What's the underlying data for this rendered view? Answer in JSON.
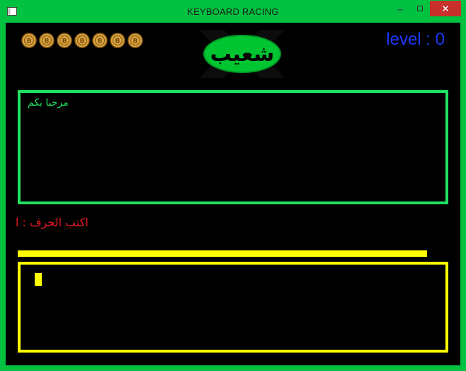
{
  "window": {
    "title": "KEYBOARD RACING"
  },
  "coins": {
    "count": 7,
    "icon": "bitcoin-coin-icon",
    "symbol": "B"
  },
  "logo": {
    "text": "شعيب"
  },
  "level": {
    "text": "level : 0"
  },
  "message": {
    "text": "مرحبا بكم"
  },
  "prompt": {
    "text": "اكتب الحرف : ا"
  },
  "progress": {
    "value": 1.0
  },
  "input": {
    "value": ""
  },
  "colors": {
    "frame": "#00c140",
    "message_border": "#1fe060",
    "level_text": "#1a3bff",
    "prompt_text": "#ee1c24",
    "input_border": "#ffff00",
    "coin": "#d9a543"
  }
}
